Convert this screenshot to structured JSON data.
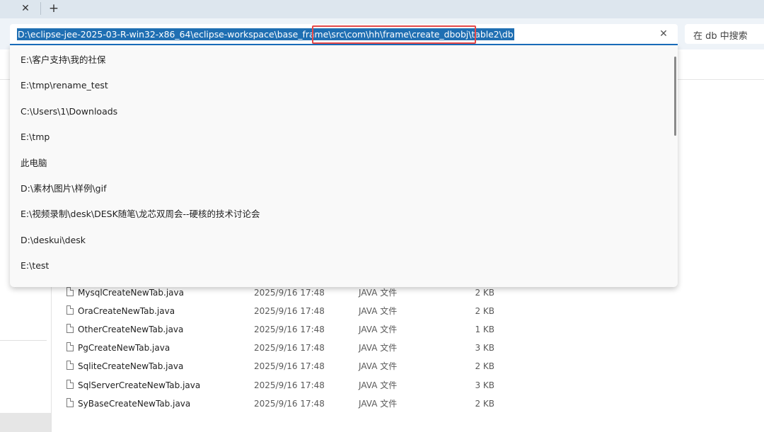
{
  "tabs": {
    "close_glyph": "✕",
    "new_glyph": "+"
  },
  "address_bar": {
    "path": "D:\\eclipse-jee-2025-03-R-win32-x86_64\\eclipse-workspace\\base_frame\\src\\com\\hh\\frame\\create_dbobj\\table2\\db",
    "clear_glyph": "✕"
  },
  "search": {
    "placeholder": "在 db 中搜索"
  },
  "history": [
    "E:\\客户支持\\我的社保",
    "E:\\tmp\\rename_test",
    "C:\\Users\\1\\Downloads",
    "E:\\tmp",
    "此电脑",
    "D:\\素材\\图片\\样例\\gif",
    "E:\\视频录制\\desk\\DESK随笔\\龙芯双周会--硬核的技术讨论会",
    "D:\\deskui\\desk",
    "E:\\test"
  ],
  "files": [
    {
      "name": "MysqlCreateNewTab.java",
      "date": "2025/9/16 17:48",
      "type": "JAVA 文件",
      "size": "2 KB"
    },
    {
      "name": "OraCreateNewTab.java",
      "date": "2025/9/16 17:48",
      "type": "JAVA 文件",
      "size": "2 KB"
    },
    {
      "name": "OtherCreateNewTab.java",
      "date": "2025/9/16 17:48",
      "type": "JAVA 文件",
      "size": "1 KB"
    },
    {
      "name": "PgCreateNewTab.java",
      "date": "2025/9/16 17:48",
      "type": "JAVA 文件",
      "size": "3 KB"
    },
    {
      "name": "SqliteCreateNewTab.java",
      "date": "2025/9/16 17:48",
      "type": "JAVA 文件",
      "size": "2 KB"
    },
    {
      "name": "SqlServerCreateNewTab.java",
      "date": "2025/9/16 17:48",
      "type": "JAVA 文件",
      "size": "3 KB"
    },
    {
      "name": "SyBaseCreateNewTab.java",
      "date": "2025/9/16 17:48",
      "type": "JAVA 文件",
      "size": "2 KB"
    }
  ],
  "colors": {
    "selection": "#1f6fb3",
    "annotation": "#e54848",
    "focus": "#1a6fbf"
  }
}
